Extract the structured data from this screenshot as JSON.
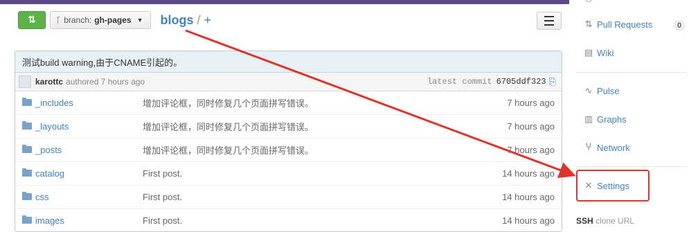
{
  "toolbar": {
    "branch_prefix": "branch:",
    "branch_name": "gh-pages",
    "repo": "blogs",
    "separator": "/",
    "add": "+"
  },
  "commit": {
    "message": "测试build warning,由于CNAME引起的。",
    "author": "karottc",
    "authored_text": "authored 7 hours ago",
    "latest_label": "latest commit",
    "sha": "6705ddf323"
  },
  "files": [
    {
      "name": "_includes",
      "message": "增加评论框，同时修复几个页面拼写错误。",
      "age": "7 hours ago"
    },
    {
      "name": "_layouts",
      "message": "增加评论框，同时修复几个页面拼写错误。",
      "age": "7 hours ago"
    },
    {
      "name": "_posts",
      "message": "增加评论框，同时修复几个页面拼写错误。",
      "age": "7 hours ago"
    },
    {
      "name": "catalog",
      "message": "First post.",
      "age": "14 hours ago"
    },
    {
      "name": "css",
      "message": "First post.",
      "age": "14 hours ago"
    },
    {
      "name": "images",
      "message": "First post.",
      "age": "14 hours ago"
    }
  ],
  "sidebar": {
    "pull_requests": "Pull Requests",
    "pull_requests_count": "0",
    "wiki": "Wiki",
    "pulse": "Pulse",
    "graphs": "Graphs",
    "network": "Network",
    "settings": "Settings"
  },
  "ssh": {
    "label": "SSH",
    "text": "clone URL"
  },
  "colors": {
    "accent": "#4183c4",
    "highlight": "#e0332a",
    "compare": "#5eb348"
  }
}
